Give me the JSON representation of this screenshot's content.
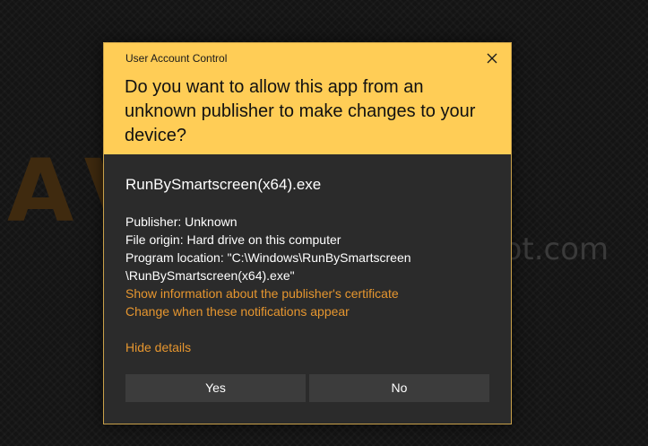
{
  "wallpaper": {
    "logo_text": "AVOLUS",
    "url_text": "pot.com"
  },
  "dialog": {
    "title": "User Account Control",
    "question": "Do you want to allow this app from an unknown publisher to make changes to your device?",
    "app_name": "RunBySmartscreen(x64).exe",
    "publisher": "Publisher: Unknown",
    "file_origin": "File origin: Hard drive on this computer",
    "program_location_line1": "Program location: \"C:\\Windows\\RunBySmartscreen",
    "program_location_line2": "\\RunBySmartscreen(x64).exe\"",
    "link_certificate": "Show information about the publisher's certificate",
    "link_notifications": "Change when these notifications appear",
    "link_hide_details": "Hide details",
    "yes_label": "Yes",
    "no_label": "No"
  },
  "colors": {
    "header_bg": "#ffcd56",
    "body_bg": "#2b2b2b",
    "link": "#e6962f",
    "button_bg": "#3c3c3c"
  },
  "icons": {
    "close": "close-icon"
  }
}
